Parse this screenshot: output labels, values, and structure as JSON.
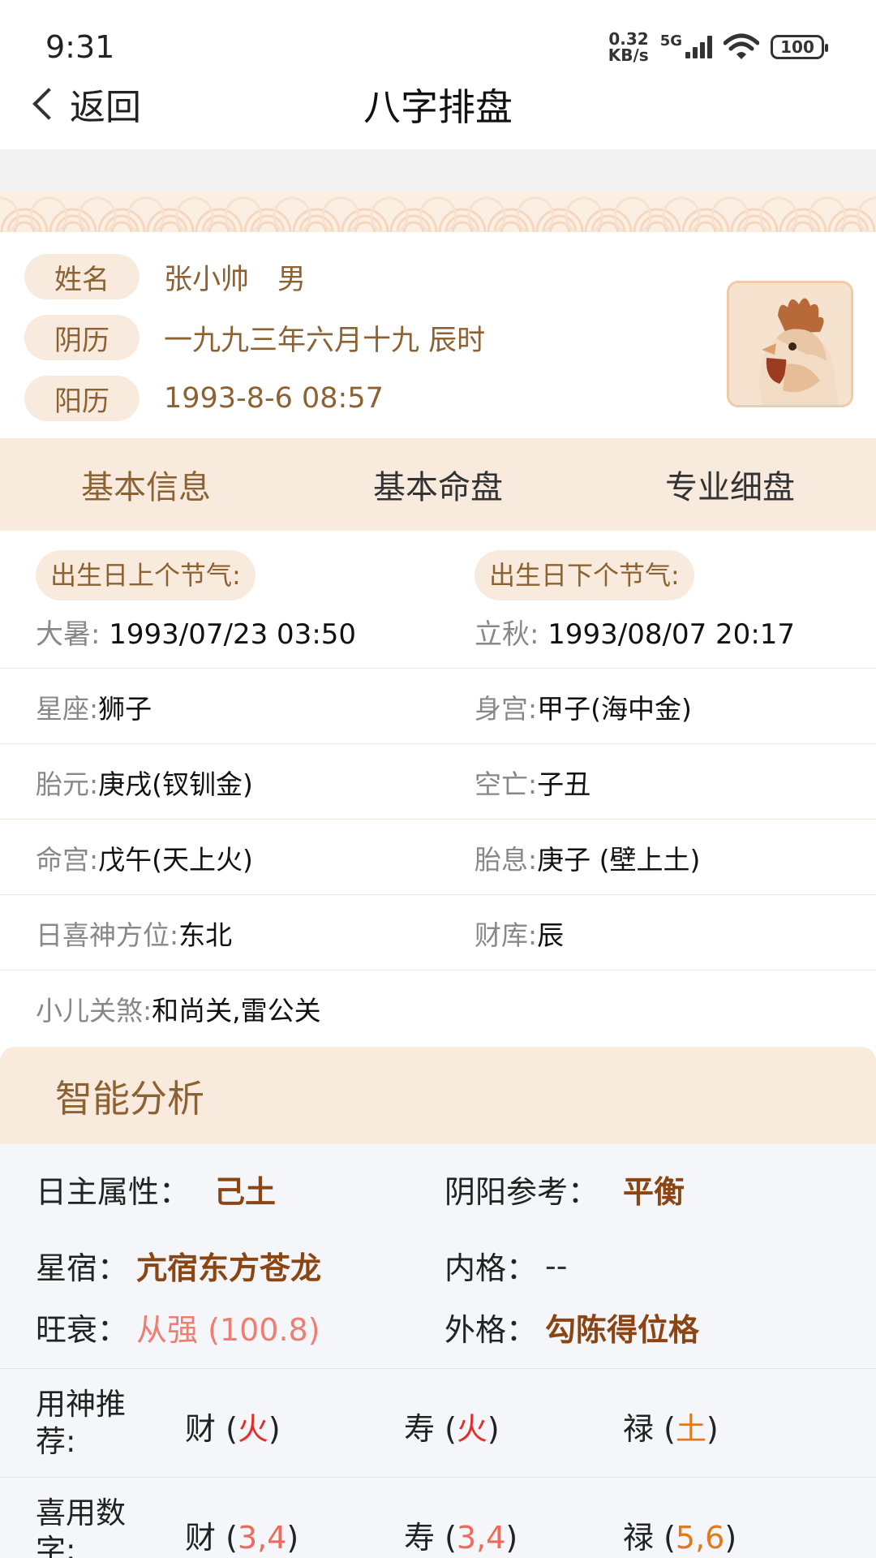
{
  "status_bar": {
    "time": "9:31",
    "net_speed_value": "0.32",
    "net_speed_unit": "KB/s",
    "network_type": "5G",
    "battery": "100"
  },
  "nav": {
    "back_label": "返回",
    "title": "八字排盘"
  },
  "profile": {
    "rows": [
      {
        "tag": "姓名",
        "value": "张小帅　男"
      },
      {
        "tag": "阴历",
        "value": "一九九三年六月十九 辰时"
      },
      {
        "tag": "阳历",
        "value": "1993-8-6 08:57"
      }
    ],
    "avatar_icon": "rooster-icon"
  },
  "tabs": [
    {
      "label": "基本信息",
      "active": true
    },
    {
      "label": "基本命盘",
      "active": false
    },
    {
      "label": "专业细盘",
      "active": false
    }
  ],
  "jieqi": {
    "prev": {
      "tag": "出生日上个节气:",
      "label": "大暑:",
      "value": " 1993/07/23 03:50"
    },
    "next": {
      "tag": "出生日下个节气:",
      "label": "立秋:",
      "value": " 1993/08/07 20:17"
    }
  },
  "info_rows": [
    {
      "l_label": "星座:",
      "l_value": "狮子",
      "r_label": "身宫:",
      "r_value": "甲子(海中金)"
    },
    {
      "l_label": "胎元:",
      "l_value": "庚戌(钗钏金)",
      "r_label": "空亡:",
      "r_value": "子丑"
    },
    {
      "l_label": "命宫:",
      "l_value": "戊午(天上火)",
      "r_label": "胎息:",
      "r_value": "庚子 (壁上土)"
    },
    {
      "l_label": "日喜神方位:",
      "l_value": "东北",
      "r_label": "财库:",
      "r_value": "辰"
    },
    {
      "l_label": "小儿关煞:",
      "l_value": "和尚关,雷公关",
      "r_label": "",
      "r_value": ""
    }
  ],
  "analysis": {
    "title": "智能分析",
    "rizhu_label": "日主属性：",
    "rizhu_value": "己土",
    "yinyang_label": "阴阳参考：",
    "yinyang_value": "平衡",
    "xingxiu_label": "星宿：",
    "xingxiu_value": "亢宿东方苍龙",
    "neige_label": "内格：",
    "neige_value": "--",
    "wangshuai_label": "旺衰：",
    "wangshuai_value": "从强 (100.8)",
    "waige_label": "外格：",
    "waige_value": "勾陈得位格",
    "yongshen": {
      "label": "用神推荐:",
      "items": [
        {
          "name": "财 (",
          "value": "火",
          "close": ")"
        },
        {
          "name": "寿 (",
          "value": "火",
          "close": ")"
        },
        {
          "name": "禄 (",
          "value": "土",
          "close": ")"
        }
      ]
    },
    "numbers": {
      "label": "喜用数字:",
      "items": [
        {
          "name": "财 (",
          "value": "3,4",
          "close": ")"
        },
        {
          "name": "寿 (",
          "value": "3,4",
          "close": ")"
        },
        {
          "name": "禄 (",
          "value": "5,6",
          "close": ")"
        }
      ]
    }
  },
  "colors": {
    "accent_brown": "#8d6233",
    "tag_bg": "#f8ebde",
    "value_brown": "#8b4513",
    "fire_red": "#e2312c",
    "earth_orange": "#e07a1f"
  }
}
